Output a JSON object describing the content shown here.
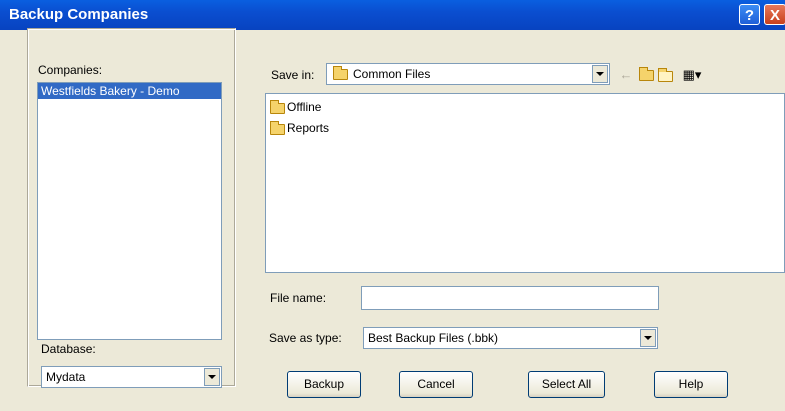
{
  "window": {
    "title": "Backup Companies",
    "help_glyph": "?",
    "close_glyph": "X"
  },
  "left_panel": {
    "companies_label": "Companies:",
    "companies": [
      "Westfields Bakery - Demo"
    ],
    "database_label": "Database:",
    "database_value": "Mydata"
  },
  "save_in": {
    "label": "Save in:",
    "value": "Common Files"
  },
  "toolbar": {
    "back_icon": "back-arrow-icon",
    "up_icon": "up-folder-icon",
    "new_folder_icon": "new-folder-icon",
    "views_icon": "views-menu-icon"
  },
  "files": [
    {
      "name": "Offline",
      "icon": "folder-icon"
    },
    {
      "name": "Reports",
      "icon": "folder-icon"
    }
  ],
  "file_name": {
    "label": "File name:",
    "value": ""
  },
  "save_as_type": {
    "label": "Save as type:",
    "value": "Best Backup Files (.bbk)"
  },
  "buttons": {
    "backup": "Backup",
    "cancel": "Cancel",
    "select_all": "Select All",
    "help": "Help"
  },
  "colors": {
    "title_bar": "#0a4ed0",
    "selection": "#316ac5",
    "dialog_bg": "#ece9d8"
  }
}
